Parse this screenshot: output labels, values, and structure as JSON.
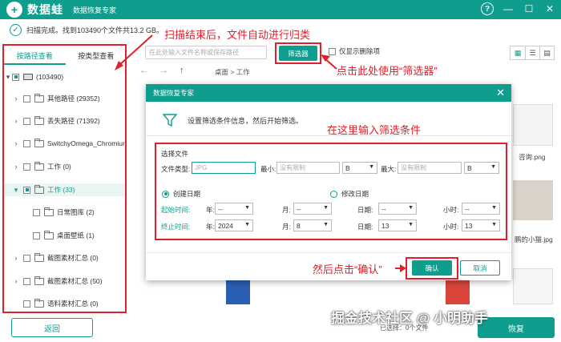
{
  "app": {
    "name": "数据蛙",
    "subtitle": "数据恢复专家",
    "logo_glyph": "+"
  },
  "window": {
    "help": "?",
    "minimize": "—",
    "maximize": "☐",
    "close": "✕"
  },
  "status": {
    "text": "扫描完成。找到103490个文件共13.2 GB。"
  },
  "annotations": {
    "scan_done": "扫描结束后，文件自动进行归类",
    "use_filter": "点击此处使用“筛选器”",
    "enter_conditions": "在这里输入筛选条件",
    "then_confirm": "然后点击“确认”"
  },
  "sidebar": {
    "tabs": [
      "按路径查看",
      "按类型查看"
    ],
    "root_label": "(103490)",
    "items": [
      {
        "label": "其他路径 (29352)"
      },
      {
        "label": "丢失路径 (71392)"
      },
      {
        "label": "SwitchyOmega_Chromiur"
      },
      {
        "label": "工作 (0)"
      },
      {
        "label": "工作 (33)"
      },
      {
        "label": "日常图库 (2)"
      },
      {
        "label": "桌面壁纸 (1)"
      },
      {
        "label": "截图素材汇总 (0)"
      },
      {
        "label": "截图素材汇总 (50)"
      },
      {
        "label": "语料素材汇总 (0)"
      }
    ],
    "back_label": "返回"
  },
  "toolbar": {
    "search_placeholder": "在此处输入文件名称或保存路径",
    "filter_label": "筛选器",
    "deleted_only_label": "仅显示删除项",
    "breadcrumb": "桌面 > 工作"
  },
  "background": {
    "file_label_1": "咨询.png",
    "file_label_2": "鹏的小猫.jpg",
    "selected_info": "已选择：0个文件",
    "recover_label": "恢复"
  },
  "dialog": {
    "title": "数据恢复专家",
    "info": "设置筛选条件信息，然后开始筛选。",
    "section_label": "选择文件",
    "file_type_label": "文件类型:",
    "file_type_placeholder": "JPG",
    "min_label": "最小:",
    "min_placeholder": "没有限制",
    "min_unit": "B",
    "max_label": "最大:",
    "max_placeholder": "没有限制",
    "max_unit": "B",
    "radio_created": "创建日期",
    "radio_modified": "修改日期",
    "start_label": "起始时间:",
    "end_label": "终止时间:",
    "year_label": "年:",
    "month_label": "月:",
    "day_label": "日期:",
    "hour_label": "小时:",
    "start": {
      "year": "--",
      "month": "--",
      "day": "--",
      "hour": "--"
    },
    "end": {
      "year": "2024",
      "month": "8",
      "day": "13",
      "hour": "13"
    },
    "ok_label": "确认",
    "cancel_label": "取消"
  },
  "watermark": "掘金技术社区 @ 小明助手",
  "colors": {
    "accent": "#0f9d8d",
    "annotation": "#e0202a"
  }
}
